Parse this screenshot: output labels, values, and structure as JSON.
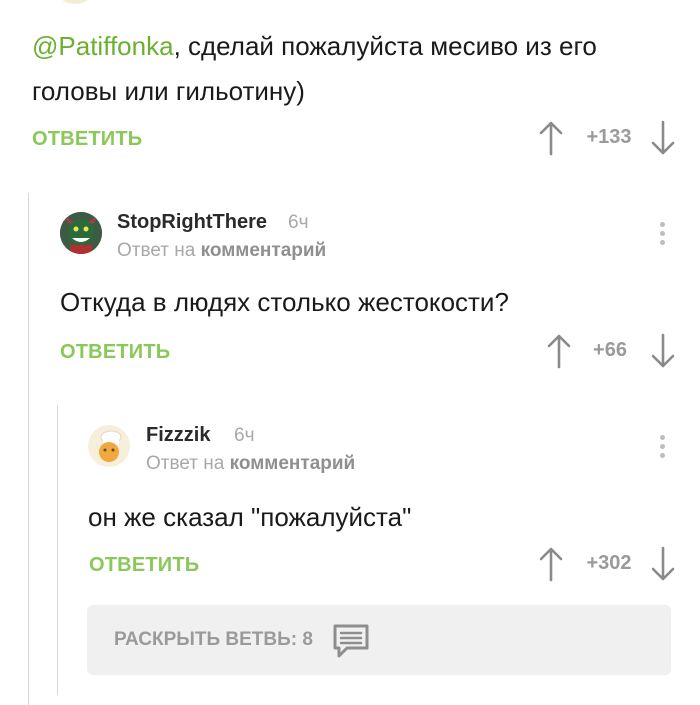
{
  "comments": [
    {
      "mention": "@Patiffonka",
      "text_line1_rest": ", сделай пожалуйста месиво из его",
      "text_line2": "головы или гильотину)",
      "reply_label": "ОТВЕТИТЬ",
      "score": "+133"
    },
    {
      "username": "StopRightThere",
      "time": "6ч",
      "meta_prefix": "Ответ на",
      "meta_link": "комментарий",
      "text": "Откуда в людях столько жестокости?",
      "reply_label": "ОТВЕТИТЬ",
      "score": "+66"
    },
    {
      "username": "Fizzzik",
      "time": "6ч",
      "meta_prefix": "Ответ на",
      "meta_link": "комментарий",
      "text": "он же сказал \"пожалуйста\"",
      "reply_label": "ОТВЕТИТЬ",
      "score": "+302"
    }
  ],
  "expand_thread": {
    "label": "РАСКРЫТЬ ВЕТВЬ: 8"
  },
  "icons": {
    "upvote": "arrow-up-icon",
    "downvote": "arrow-down-icon",
    "more": "more-vertical-icon",
    "comments": "comment-bubble-icon"
  },
  "colors": {
    "accent_green": "#8ac858",
    "mention_green": "#6bb030",
    "muted_gray": "#9a9a9a"
  }
}
